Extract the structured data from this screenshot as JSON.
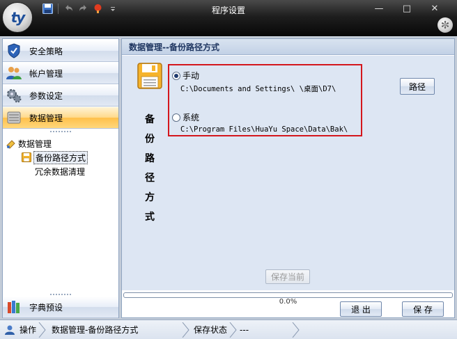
{
  "app": {
    "logo_text": "ty",
    "title": "程序设置",
    "window_buttons": {
      "minimize": "—",
      "maximize": "□",
      "close": "✕"
    }
  },
  "quick_access": [
    "save-icon",
    "undo-icon",
    "redo-icon",
    "paint-icon",
    "dropdown-icon"
  ],
  "sidebar": {
    "items": [
      {
        "label": "安全策略",
        "icon": "shield-icon"
      },
      {
        "label": "帐户管理",
        "icon": "users-icon"
      },
      {
        "label": "参数设定",
        "icon": "gears-icon"
      },
      {
        "label": "数据管理",
        "icon": "database-icon",
        "active": true
      }
    ],
    "tree": {
      "root": "数据管理",
      "children": [
        {
          "label": "备份路径方式",
          "selected": true
        },
        {
          "label": "冗余数据清理"
        }
      ]
    },
    "bottom_item": {
      "label": "字典预设",
      "icon": "books-icon"
    }
  },
  "content": {
    "header": "数据管理--备份路径方式",
    "vertical_title": [
      "备",
      "份",
      "路",
      "径",
      "方",
      "式"
    ],
    "options": [
      {
        "label": "手动",
        "path": "C:\\Documents and Settings\\      \\桌面\\D7\\",
        "checked": true
      },
      {
        "label": "系统",
        "path": "C:\\Program Files\\HuaYu Space\\Data\\Bak\\",
        "checked": false
      }
    ],
    "path_button": "路径",
    "save_current_button": "保存当前",
    "progress_text": "0.0%",
    "progress_value": 0.0
  },
  "footer_buttons": {
    "exit": "退 出",
    "save": "保 存"
  },
  "statusbar": {
    "operation_label": "操作",
    "operation_value": "数据管理-备份路径方式",
    "save_state_label": "保存状态",
    "save_state_value": "---"
  }
}
